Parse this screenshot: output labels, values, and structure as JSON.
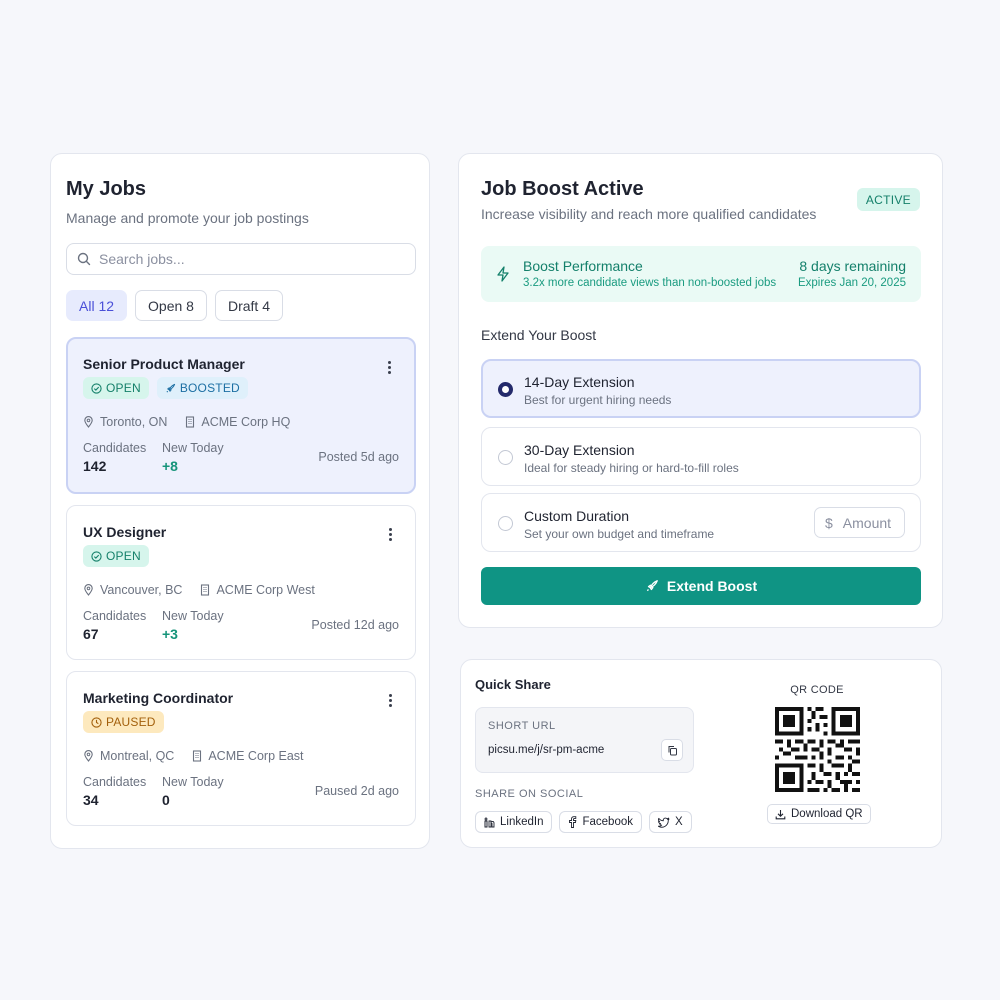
{
  "jobs_panel": {
    "title": "My Jobs",
    "subtitle": "Manage and promote your job postings",
    "search_placeholder": "Search jobs...",
    "filters": [
      {
        "label": "All 12",
        "active": true
      },
      {
        "label": "Open 8",
        "active": false
      },
      {
        "label": "Draft 4",
        "active": false
      }
    ],
    "jobs": [
      {
        "title": "Senior Product Manager",
        "badges": [
          "OPEN",
          "BOOSTED"
        ],
        "location": "Toronto, ON",
        "office": "ACME Corp HQ",
        "candidates_label": "Candidates",
        "candidates": "142",
        "new_label": "New Today",
        "new_today": "+8",
        "posted": "Posted 5d ago"
      },
      {
        "title": "UX Designer",
        "badges": [
          "OPEN"
        ],
        "location": "Vancouver, BC",
        "office": "ACME Corp West",
        "candidates_label": "Candidates",
        "candidates": "67",
        "new_label": "New Today",
        "new_today": "+3",
        "posted": "Posted 12d ago"
      },
      {
        "title": "Marketing Coordinator",
        "badges": [
          "PAUSED"
        ],
        "location": "Montreal, QC",
        "office": "ACME Corp East",
        "candidates_label": "Candidates",
        "candidates": "34",
        "new_label": "New Today",
        "new_today": "0",
        "posted": "Paused 2d ago"
      }
    ]
  },
  "boost_panel": {
    "title": "Job Boost Active",
    "subtitle": "Increase visibility and reach more qualified candidates",
    "status_badge": "ACTIVE",
    "performance": {
      "title": "Boost Performance",
      "detail": "3.2x more candidate views than non-boosted jobs",
      "remaining": "8 days remaining",
      "expires": "Expires Jan 20, 2025"
    },
    "extend_label": "Extend Your Boost",
    "options": [
      {
        "title": "14-Day Extension",
        "subtitle": "Best for urgent hiring needs",
        "selected": true
      },
      {
        "title": "30-Day Extension",
        "subtitle": "Ideal for steady hiring or hard-to-fill roles",
        "selected": false
      },
      {
        "title": "Custom Duration",
        "subtitle": "Set your own budget and timeframe",
        "selected": false
      }
    ],
    "amount_placeholder": "Amount",
    "currency_symbol": "$",
    "extend_button": "Extend Boost"
  },
  "quick_share": {
    "title": "Quick Share",
    "short_url_label": "SHORT URL",
    "short_url": "picsu.me/j/sr-pm-acme",
    "social_label": "SHARE ON SOCIAL",
    "socials": [
      "LinkedIn",
      "Facebook",
      "X"
    ],
    "qr_label": "QR CODE",
    "download_label": "Download QR"
  },
  "colors": {
    "accent_teal": "#0f9484",
    "selected_bg": "#eef1fd",
    "open_badge": "#d6f5ec",
    "boosted_badge": "#dff0fb",
    "paused_badge": "#fde9be"
  }
}
